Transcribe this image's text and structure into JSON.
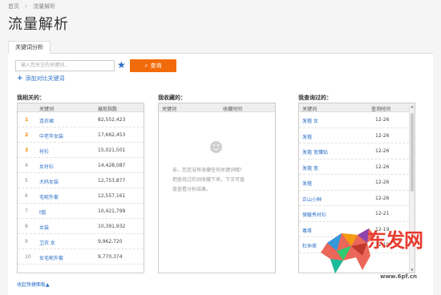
{
  "breadcrumb": {
    "home": "首页",
    "current": "流量解析"
  },
  "page_title": "流量解析",
  "tabs": [
    {
      "label": "关键词分析",
      "active": true
    }
  ],
  "search": {
    "placeholder": "输入您关注的关键词...",
    "button_label": "查询"
  },
  "add_compare_label": "添加对比关键词",
  "related": {
    "label": "我相关的：",
    "headers": [
      "关键词",
      "展现指数"
    ],
    "rows": [
      {
        "rank": "1",
        "keyword": "连衣裙",
        "value": "82,552,423"
      },
      {
        "rank": "2",
        "keyword": "中老年女装",
        "value": "17,662,453"
      },
      {
        "rank": "3",
        "keyword": "衬衫",
        "value": "15,021,501"
      },
      {
        "rank": "4",
        "keyword": "女衬衫",
        "value": "14,428,087"
      },
      {
        "rank": "5",
        "keyword": "大码女装",
        "value": "12,753,877"
      },
      {
        "rank": "6",
        "keyword": "毛呢外套",
        "value": "12,557,161"
      },
      {
        "rank": "7",
        "keyword": "t恤",
        "value": "10,421,799"
      },
      {
        "rank": "8",
        "keyword": "女装",
        "value": "10,391,932"
      },
      {
        "rank": "9",
        "keyword": "卫衣 女",
        "value": "9,962,720"
      },
      {
        "rank": "10",
        "keyword": "女毛呢外套",
        "value": "9,770,374"
      }
    ]
  },
  "favorites": {
    "label": "我收藏的：",
    "headers": [
      "关键词",
      "收藏时间"
    ],
    "empty_line1": "亲，您还没有收藏任何关键词哦！",
    "empty_line2": "把查找过的词收藏下来，下次可直",
    "empty_line3": "接查看分析结果。"
  },
  "history": {
    "label": "我查询过的：",
    "headers": [
      "关键词",
      "查询时间"
    ],
    "rows": [
      {
        "keyword": "发箍 女",
        "time": "12-26"
      },
      {
        "keyword": "发箍",
        "time": "12-26"
      },
      {
        "keyword": "发箍 宽镶钻",
        "time": "12-26"
      },
      {
        "keyword": "发箍 宽",
        "time": "12-26"
      },
      {
        "keyword": "发箍",
        "time": "12-26"
      },
      {
        "keyword": "正山小种",
        "time": "12-26"
      },
      {
        "keyword": "保暖秀衬衫",
        "time": "12-21"
      },
      {
        "keyword": "毒茶",
        "time": "12-19"
      },
      {
        "keyword": "杜仲茶",
        "time": "12-19"
      }
    ]
  },
  "collapse_label": "收起快捷面板",
  "watermark": {
    "brand": "东发网",
    "url": "www.6pf.cn"
  },
  "colors": {
    "accent": "#f26b0a",
    "link": "#2a6fc7",
    "rank_top": "#f08a00"
  }
}
